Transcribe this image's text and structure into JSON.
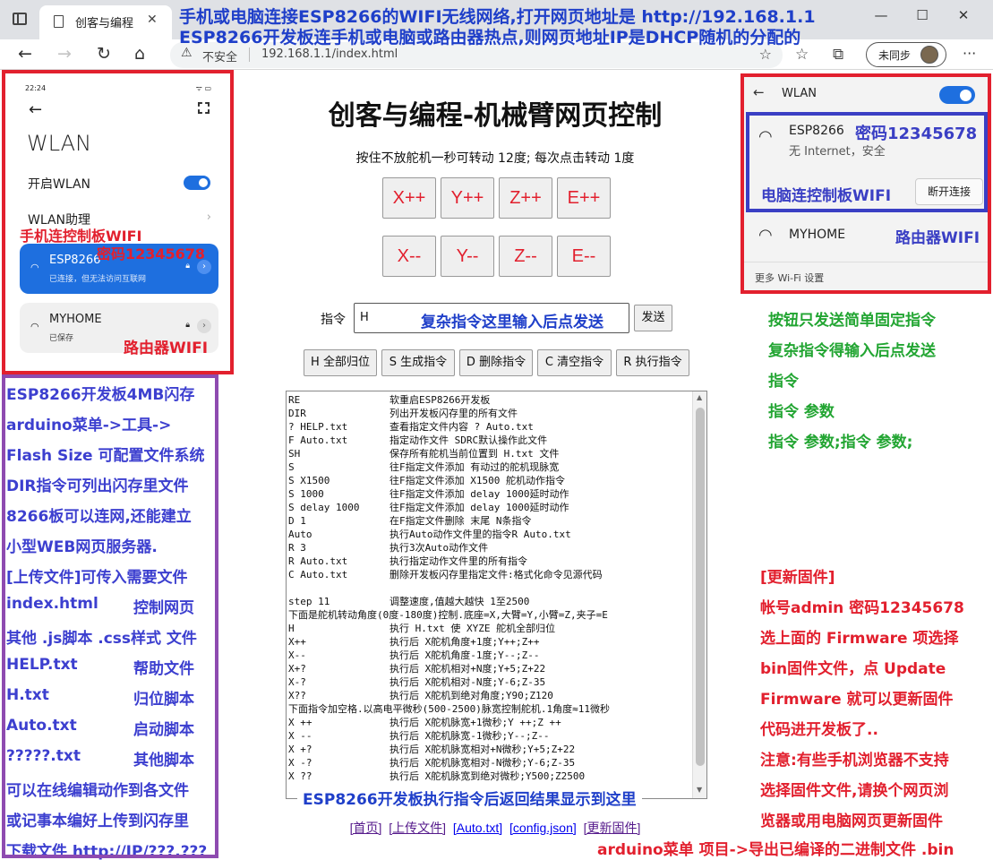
{
  "browser": {
    "tab_title": "创客与编程",
    "tab_close": "✕",
    "insecure_label": "不安全",
    "url": "192.168.1.1/index.html",
    "profile_label": "未同步",
    "window_controls": [
      "—",
      "☐",
      "✕"
    ]
  },
  "top_notes": {
    "line1": "手机或电脑连接ESP8266的WIFI无线网络,打开网页地址是 http://192.168.1.1",
    "line2": "ESP8266开发板连手机或电脑或路由器热点,则网页地址IP是DHCP随机的分配的"
  },
  "phone": {
    "time": "22:24",
    "title": "WLAN",
    "enable_label": "开启WLAN",
    "assistant_label": "WLAN助理",
    "networks": [
      {
        "name": "ESP8266",
        "status": "已连接，但无法访问互联网"
      },
      {
        "name": "MYHOME",
        "status": "已保存"
      }
    ],
    "anno_phone_wifi": "手机连控制板WIFI",
    "anno_password": "密码12345678",
    "anno_router": "路由器WIFI"
  },
  "pc_wlan": {
    "title": "WLAN",
    "networks": [
      {
        "name": "ESP8266",
        "status": "无 Internet，安全"
      },
      {
        "name": "MYHOME"
      }
    ],
    "disconnect_label": "断开连接",
    "more_settings": "更多 Wi-Fi 设置",
    "anno_password": "密码12345678",
    "anno_pc_wifi": "电脑连控制板WIFI",
    "anno_router": "路由器WIFI"
  },
  "main": {
    "title": "创客与编程-机械臂网页控制",
    "hint": "按住不放舵机一秒可转动 12度; 每次点击转动 1度",
    "jog_plus": [
      "X++",
      "Y++",
      "Z++",
      "E++"
    ],
    "jog_minus": [
      "X--",
      "Y--",
      "Z--",
      "E--"
    ],
    "command_label": "指令",
    "command_value": "H",
    "command_anno": "复杂指令这里输入后点发送",
    "send_label": "发送",
    "actions": [
      "H 全部归位",
      "S 生成指令",
      "D 删除指令",
      "C 清空指令",
      "R 执行指令"
    ],
    "console_lines": [
      [
        "RE",
        "软重启ESP8266开发板"
      ],
      [
        "DIR",
        "列出开发板闪存里的所有文件"
      ],
      [
        "? HELP.txt",
        "查看指定文件内容 ? Auto.txt"
      ],
      [
        "F Auto.txt",
        "指定动作文件 SDRC默认操作此文件"
      ],
      [
        "SH",
        "保存所有舵机当前位置到 H.txt 文件"
      ],
      [
        "S",
        "往F指定文件添加 有动过的舵机现脉宽"
      ],
      [
        "S X1500",
        "往F指定文件添加 X1500 舵机动作指令"
      ],
      [
        "S 1000",
        "往F指定文件添加 delay 1000延时动作"
      ],
      [
        "S delay 1000",
        "往F指定文件添加 delay 1000延时动作"
      ],
      [
        "D 1",
        "在F指定文件删除 末尾 N条指令"
      ],
      [
        "Auto",
        "执行Auto动作文件里的指令R Auto.txt"
      ],
      [
        "R 3",
        "执行3次Auto动作文件"
      ],
      [
        "R Auto.txt",
        "执行指定动作文件里的所有指令"
      ],
      [
        "C Auto.txt",
        "删除开发板闪存里指定文件:格式化命令见源代码"
      ],
      [
        "",
        ""
      ],
      [
        "step 11",
        "调整速度,值越大越快 1至2500"
      ],
      [
        "下面是舵机转动角度(0度-180度)控制.底座=X,大臂=Y,小臂=Z,夹子=E",
        ""
      ],
      [
        "H",
        "执行 H.txt 使 XYZE 舵机全部归位"
      ],
      [
        "X++",
        "执行后 X舵机角度+1度;Y++;Z++"
      ],
      [
        "X--",
        "执行后 X舵机角度-1度;Y--;Z--"
      ],
      [
        "X+?",
        "执行后 X舵机相对+N度;Y+5;Z+22"
      ],
      [
        "X-?",
        "执行后 X舵机相对-N度;Y-6;Z-35"
      ],
      [
        "X??",
        "执行后 X舵机到绝对角度;Y90;Z120"
      ],
      [
        "下面指令加空格.以高电平微秒(500-2500)脉宽控制舵机.1角度≈11微秒",
        ""
      ],
      [
        "X ++",
        "执行后 X舵机脉宽+1微秒;Y ++;Z ++"
      ],
      [
        "X --",
        "执行后 X舵机脉宽-1微秒;Y--;Z--"
      ],
      [
        "X +?",
        "执行后 X舵机脉宽相对+N微秒;Y+5;Z+22"
      ],
      [
        "X -?",
        "执行后 X舵机脉宽相对-N微秒;Y-6;Z-35"
      ],
      [
        "X ??",
        "执行后 X舵机脉宽到绝对微秒;Y500;Z2500"
      ]
    ],
    "console_anno": "ESP8266开发板执行指令后返回结果显示到这里",
    "footer_links": [
      "[首页]",
      "[上传文件]",
      "[Auto.txt]",
      "[config.json]",
      "[更新固件]"
    ]
  },
  "left_notes": [
    [
      "ESP8266开发板4MB闪存",
      ""
    ],
    [
      "arduino菜单->工具->",
      ""
    ],
    [
      "Flash Size 可配置文件系统",
      ""
    ],
    [
      "DIR指令可列出闪存里文件",
      ""
    ],
    [
      "8266板可以连网,还能建立",
      ""
    ],
    [
      "小型WEB网页服务器.",
      ""
    ],
    [
      "[上传文件]可传入需要文件",
      ""
    ],
    [
      "index.html",
      "控制网页"
    ],
    [
      "其他 .js脚本 .css样式 文件",
      ""
    ],
    [
      "HELP.txt",
      "帮助文件"
    ],
    [
      "H.txt",
      "归位脚本"
    ],
    [
      "Auto.txt",
      "启动脚本"
    ],
    [
      "?????.txt",
      "其他脚本"
    ],
    [
      "可以在线编辑动作到各文件",
      ""
    ],
    [
      "或记事本编好上传到闪存里",
      ""
    ],
    [
      "下载文件 http://IP/???.???",
      ""
    ]
  ],
  "green_notes": [
    "按钮只发送简单固定指令",
    "复杂指令得输入后点发送",
    "指令",
    "指令 参数",
    "指令 参数;指令 参数;"
  ],
  "red_notes": [
    "[更新固件]",
    "帐号admin 密码12345678",
    "选上面的 Firmware 项选择",
    "bin固件文件，点 Update",
    "Firmware 就可以更新固件",
    "代码进开发板了..",
    "注意:有些手机浏览器不支持",
    "选择固件文件,请换个网页浏",
    "览器或用电脑网页更新固件"
  ],
  "bottom_note": "arduino菜单 项目->导出已编译的二进制文件 .bin",
  "colors": {
    "red": "#e2202e",
    "blue": "#3a3fc4",
    "purple": "#8e4bb0",
    "green": "#22a532",
    "toggle_on": "#1e6fdf"
  }
}
